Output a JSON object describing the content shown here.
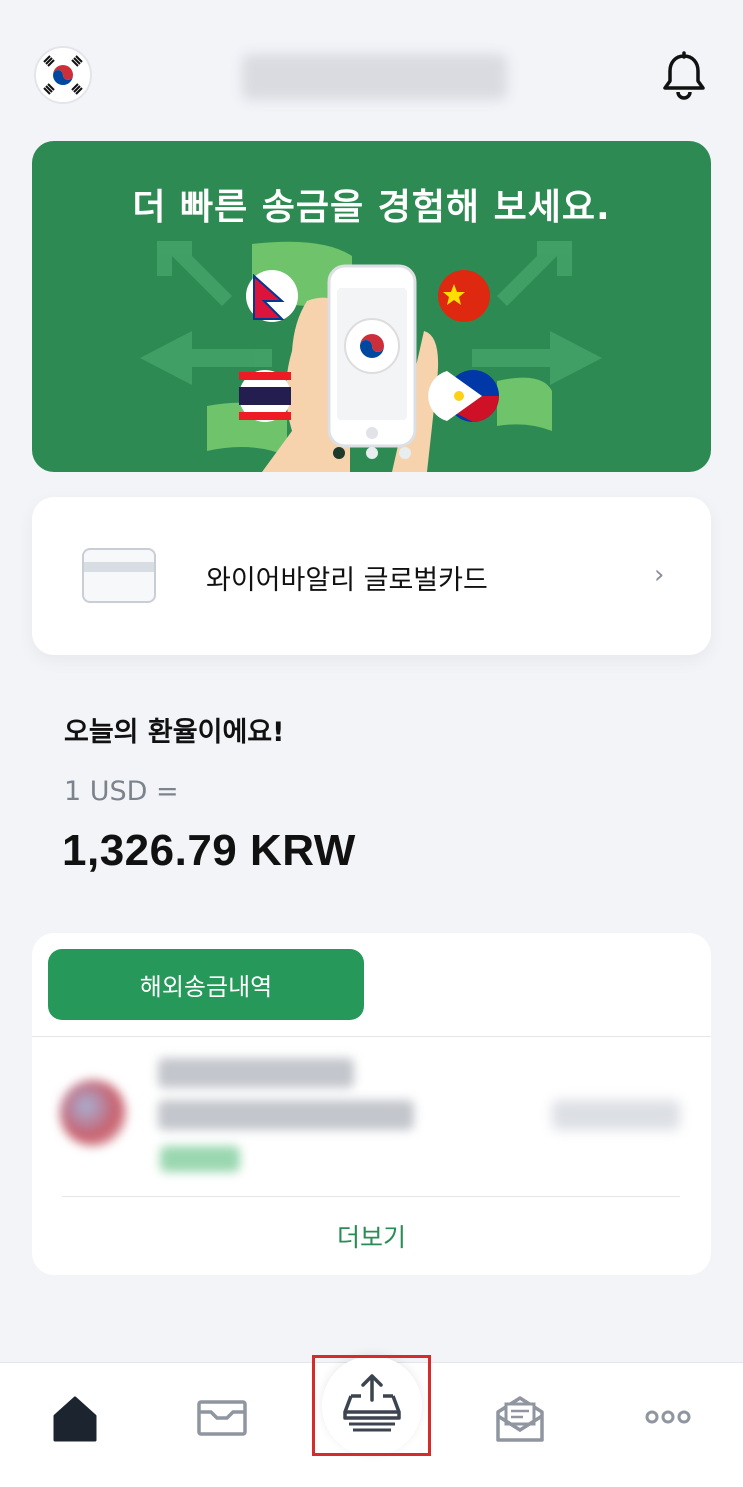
{
  "header": {
    "avatar_icon": "korea-flag-icon",
    "notification_icon": "bell-icon"
  },
  "banner": {
    "title": "더 빠른 송금을 경험해 보세요.",
    "background_color": "#2d8a52",
    "carousel_pages": 3,
    "carousel_active_page": 1
  },
  "card": {
    "label": "와이어바알리 글로벌카드",
    "chevron": "›"
  },
  "exchange_rate": {
    "heading": "오늘의 환율이에요!",
    "from": "1 USD =",
    "to": "1,326.79 KRW"
  },
  "history": {
    "tab_label": "해외송금내역",
    "more_label": "더보기",
    "accent_color": "#25985a"
  },
  "bottom_nav": {
    "items": [
      {
        "icon": "home-icon"
      },
      {
        "icon": "inbox-icon"
      },
      {
        "icon": "send-money-icon"
      },
      {
        "icon": "mail-icon"
      },
      {
        "icon": "more-icon"
      }
    ],
    "highlight_color": "#d72a2a"
  }
}
